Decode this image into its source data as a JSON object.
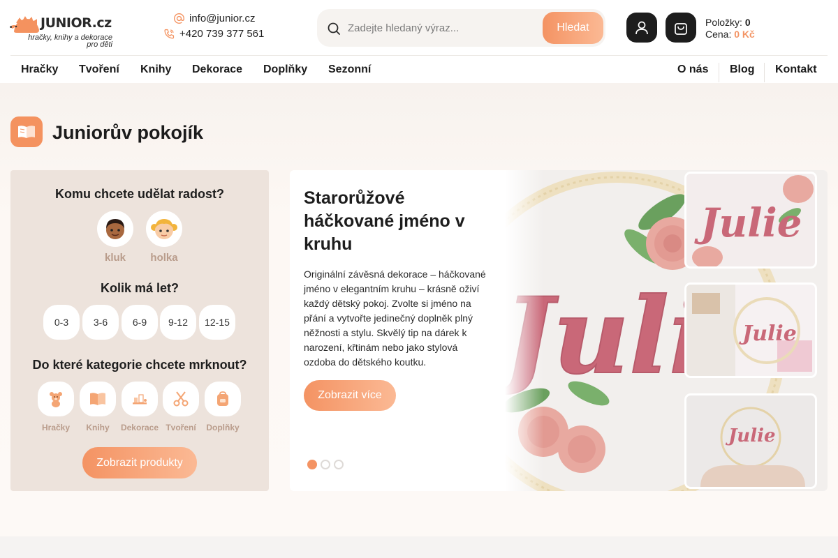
{
  "header": {
    "logo": {
      "word": "JUNIOR.cz",
      "tagline_1": "hračky, knihy a dekorace",
      "tagline_2": "pro děti"
    },
    "contact": {
      "email": "info@junior.cz",
      "phone": "+420 739 377 561",
      "email_icon": "at-icon",
      "phone_icon": "phone-icon"
    },
    "search": {
      "placeholder": "Zadejte hledaný výraz...",
      "value": "",
      "button_label": "Hledat"
    },
    "account_icon": "user-icon",
    "cart_icon": "shopping-bag-icon",
    "cart": {
      "items_label": "Položky:",
      "items_value": "0",
      "price_label": "Cena:",
      "price_value": "0 Kč"
    }
  },
  "nav": {
    "left": [
      {
        "label": "Hračky"
      },
      {
        "label": "Tvoření"
      },
      {
        "label": "Knihy"
      },
      {
        "label": "Dekorace"
      },
      {
        "label": "Doplňky"
      },
      {
        "label": "Sezonní"
      }
    ],
    "right": [
      {
        "label": "O nás"
      },
      {
        "label": "Blog"
      },
      {
        "label": "Kontakt"
      }
    ]
  },
  "page": {
    "title": "Juniorův pokojík",
    "title_icon": "open-book-icon"
  },
  "filter": {
    "gender_heading": "Komu chcete udělat radost?",
    "genders": [
      {
        "label": "kluk",
        "icon": "boy-face-icon"
      },
      {
        "label": "holka",
        "icon": "girl-face-icon"
      }
    ],
    "age_heading": "Kolik má let?",
    "ages": [
      "0-3",
      "3-6",
      "6-9",
      "9-12",
      "12-15"
    ],
    "category_heading": "Do které kategorie chcete mrknout?",
    "categories": [
      {
        "label": "Hračky",
        "icon": "teddy-bear-icon"
      },
      {
        "label": "Knihy",
        "icon": "book-icon"
      },
      {
        "label": "Dekorace",
        "icon": "decor-shelf-icon"
      },
      {
        "label": "Tvoření",
        "icon": "scissors-icon"
      },
      {
        "label": "Doplňky",
        "icon": "backpack-icon"
      }
    ],
    "submit_label": "Zobrazit produkty"
  },
  "slider": {
    "title": "Starorůžové háčkované jméno v kruhu",
    "description": "Originální závěsná dekorace – háčkované jméno v elegantním kruhu – krásně oživí každý dětský pokoj. Zvolte si jméno na přání a vytvořte jedinečný doplněk plný něžnosti a stylu. Skvělý tip na dárek k narození, křtinám nebo jako stylová ozdoba do dětského koutku.",
    "button_label": "Zobrazit více",
    "slide_count": 3,
    "active_slide": 1,
    "image_name_text": "Julie"
  },
  "colors": {
    "accent": "#f49363",
    "accent_light": "#fbb994",
    "panel_bg": "#ede3dc",
    "muted_label": "#b99c8b",
    "dark_button": "#1d1d1d"
  }
}
